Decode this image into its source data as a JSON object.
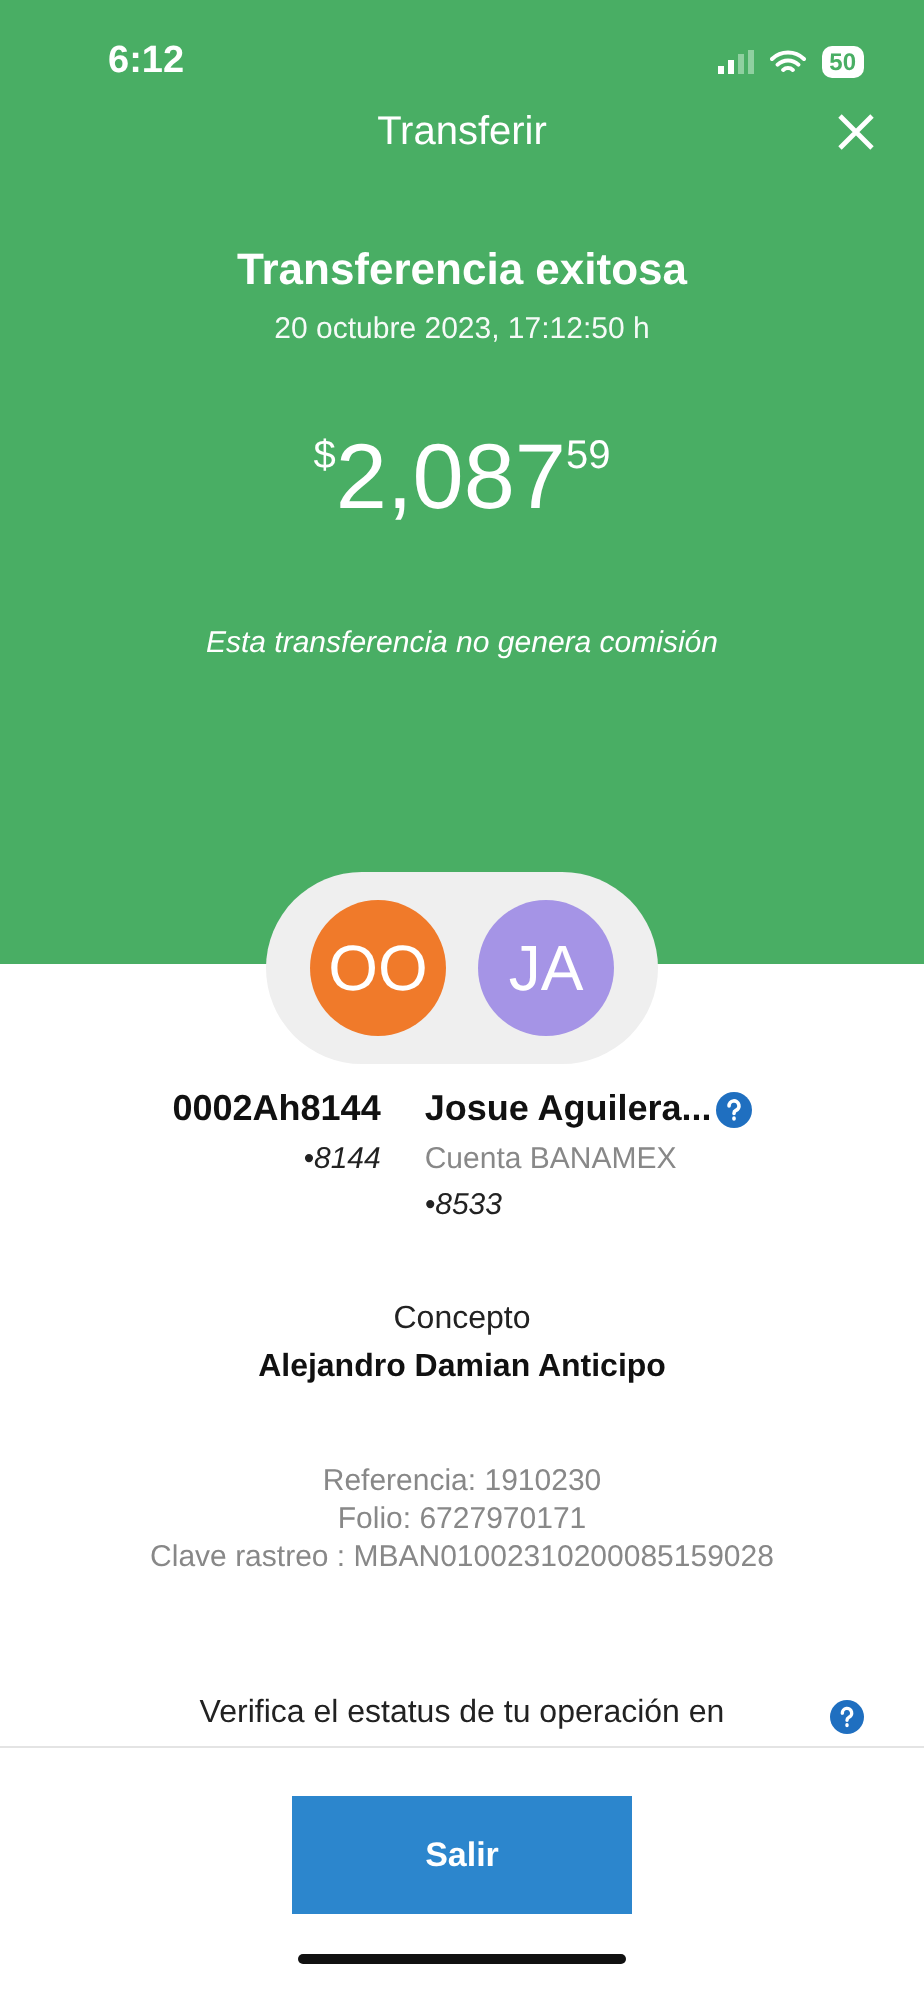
{
  "status_bar": {
    "time": "6:12",
    "battery": "50"
  },
  "header": {
    "title": "Transferir"
  },
  "receipt": {
    "title": "Transferencia exitosa",
    "date": "20 octubre 2023, 17:12:50 h",
    "amount": {
      "currency": "$",
      "whole": "2,087",
      "cents": "59"
    },
    "note": "Esta transferencia no genera comisión"
  },
  "parties": [
    {
      "initials": "OO",
      "color": "#f07a2a",
      "name": "0002Ah8144",
      "account": "•8144"
    },
    {
      "initials": "JA",
      "color": "#a594e6",
      "name": "Josue Aguilera...",
      "bank": "Cuenta BANAMEX",
      "account": "•8533"
    }
  ],
  "concept": {
    "label": "Concepto",
    "value": "Alejandro Damian Anticipo"
  },
  "details": [
    "Referencia: 1910230",
    "Folio: 6727970171",
    "Clave rastreo : MBAN01002310200085159028"
  ],
  "verify": "Verifica el estatus de tu operación en",
  "exit_button": "Salir"
}
